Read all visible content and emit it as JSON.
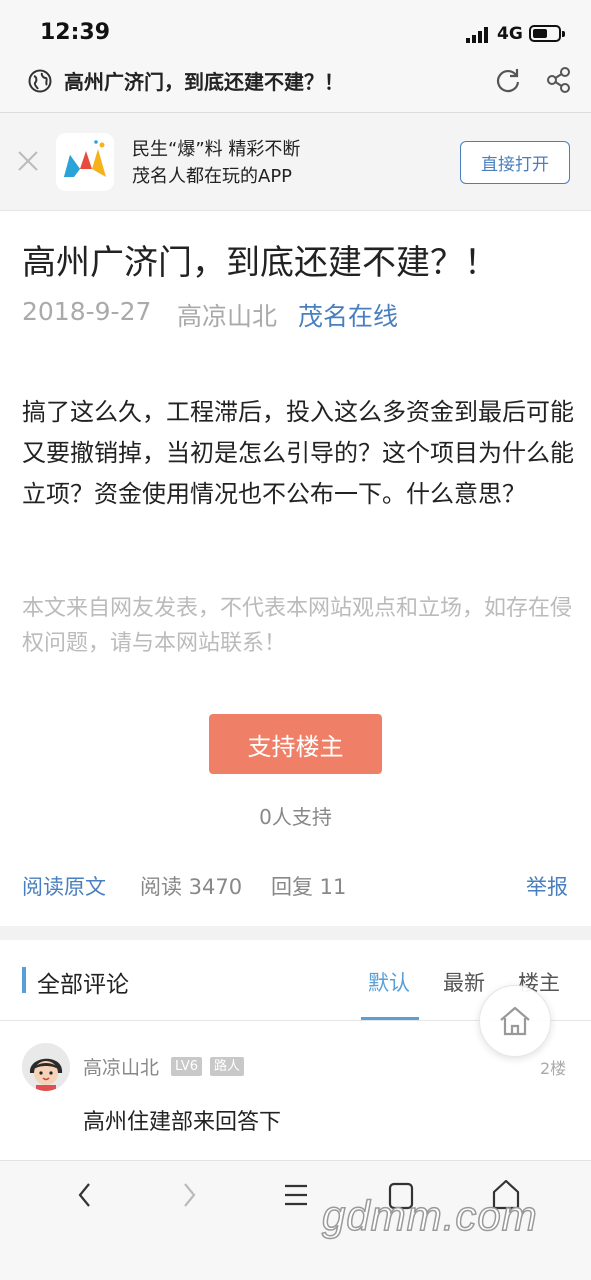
{
  "status_bar": {
    "time": "12:39",
    "network": "4G"
  },
  "browser": {
    "title": "高州广济门，到底还建不建？！"
  },
  "app_banner": {
    "line1": "民生“爆”料 精彩不断",
    "line2": "茂名人都在玩的APP",
    "open_button": "直接打开"
  },
  "article": {
    "title": "高州广济门，到底还建不建？！",
    "date": "2018-9-27",
    "author": "高凉山北",
    "source": "茂名在线",
    "body": "搞了这么久，工程滞后，投入这么多资金到最后可能又要撤销掉，当初是怎么引导的？这个项目为什么能立项？资金使用情况也不公布一下。什么意思？",
    "disclaimer": "本文来自网友发表，不代表本网站观点和立场，如存在侵权问题，请与本网站联系！",
    "support_button": "支持楼主",
    "support_count": "0人支持"
  },
  "stats": {
    "read_original": "阅读原文",
    "reads": "阅读 3470",
    "replies": "回复 11",
    "report": "举报"
  },
  "comments": {
    "header": "全部评论",
    "tabs": [
      "默认",
      "最新",
      "楼主"
    ],
    "active_tab": "默认",
    "items": [
      {
        "user": "高凉山北",
        "level": "LV6",
        "role": "路人",
        "floor": "2楼",
        "text": "高州住建部来回答下"
      }
    ]
  },
  "watermark": "gdmm.com",
  "colors": {
    "accent_blue": "#4a7fbf",
    "tab_blue": "#5aa0d8",
    "support_orange": "#ef8067"
  },
  "icons": {
    "browser": [
      "globe-icon",
      "reload-icon",
      "share-icon"
    ],
    "banner": [
      "close-icon",
      "app-logo"
    ],
    "toolbar": [
      "back-icon",
      "forward-icon",
      "menu-icon",
      "tabs-icon",
      "home-icon"
    ],
    "floating": "home-icon"
  }
}
